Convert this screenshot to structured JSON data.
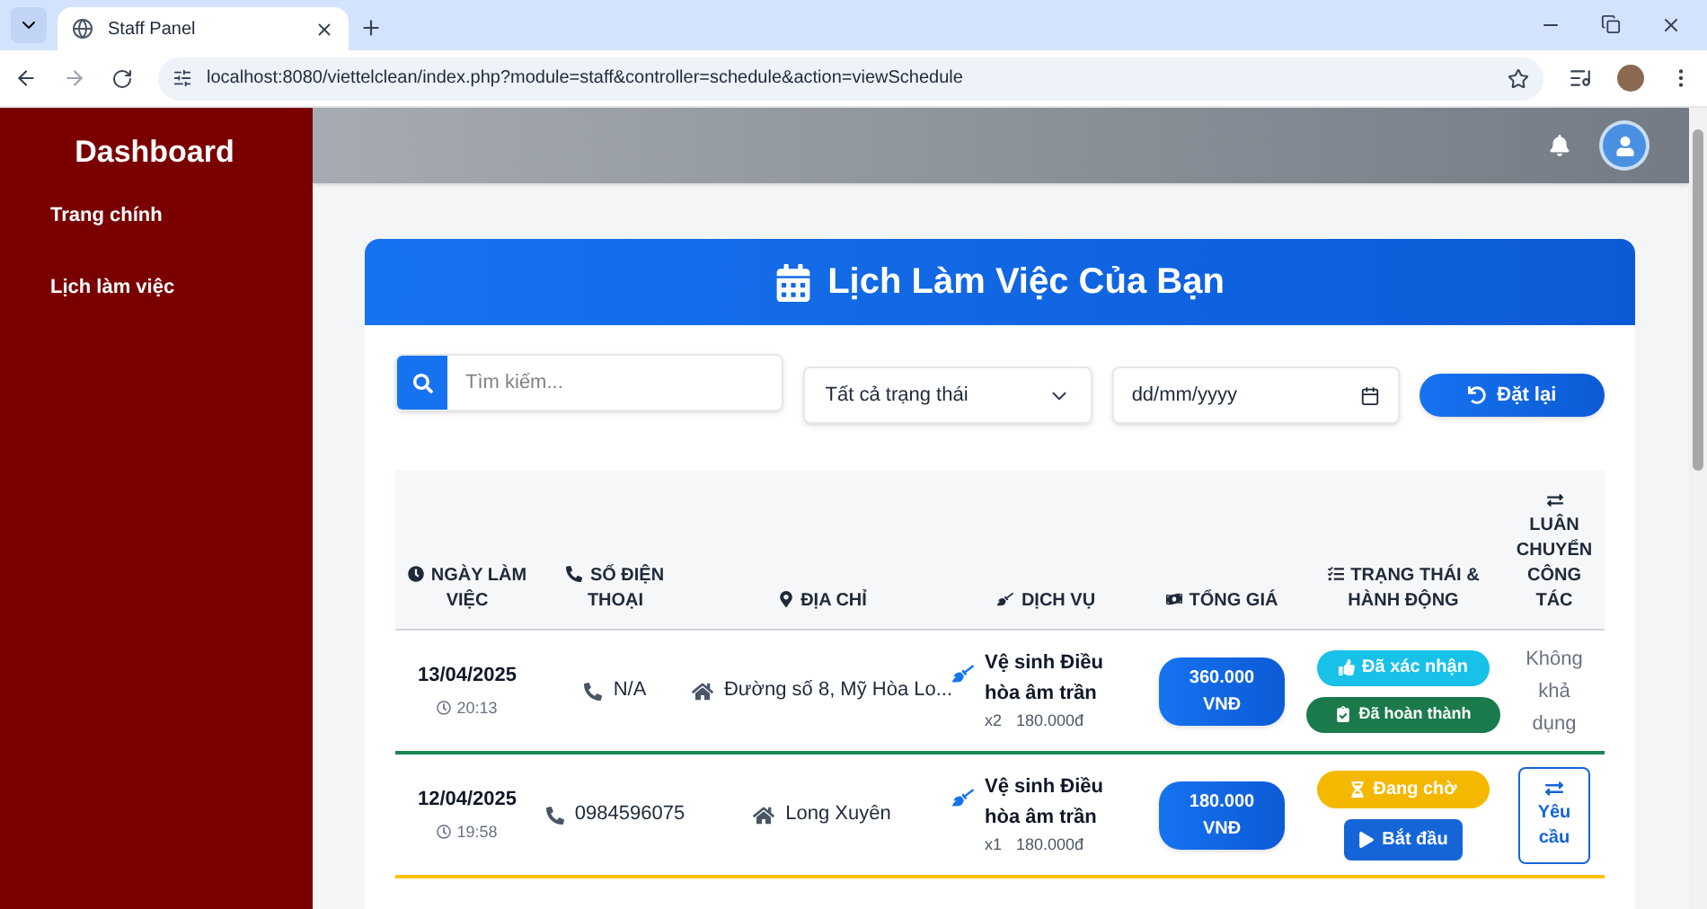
{
  "browser": {
    "tab_title": "Staff Panel",
    "url": "localhost:8080/viettelclean/index.php?module=staff&controller=schedule&action=viewSchedule"
  },
  "sidebar": {
    "title": "Dashboard",
    "items": [
      {
        "label": "Trang chính",
        "selected": false
      },
      {
        "label": "Lịch làm việc",
        "selected": false
      }
    ]
  },
  "card": {
    "title": "Lịch Làm Việc Của Bạn"
  },
  "filters": {
    "search": {
      "placeholder": "Tìm kiếm..."
    },
    "status_select": {
      "value": "Tất cả trạng thái"
    },
    "date": {
      "placeholder": "dd/mm/yyyy"
    },
    "reset_button": "Đặt lại"
  },
  "table": {
    "columns": [
      {
        "kind": "date",
        "label": "NGÀY LÀM VIỆC"
      },
      {
        "kind": "phone",
        "label": "SỐ ĐIỆN THOẠI"
      },
      {
        "kind": "address",
        "label": "ĐỊA CHỈ"
      },
      {
        "kind": "service",
        "label": "DỊCH VỤ"
      },
      {
        "kind": "total",
        "label": "TỔNG GIÁ"
      },
      {
        "kind": "status",
        "label": "TRẠNG THÁI & HÀNH ĐỘNG"
      },
      {
        "kind": "transfer",
        "label": "LUÂN CHUYỂN CÔNG TÁC"
      }
    ],
    "rows": [
      {
        "date": "13/04/2025",
        "time": "20:13",
        "phone": "N/A",
        "address": "Đường số 8, Mỹ Hòa Lo...",
        "service": "Vệ sinh Điều hòa âm trần",
        "quantity": "x2",
        "unit_price": "180.000đ",
        "total": [
          "360.000",
          "VNĐ"
        ],
        "actions": [
          {
            "kind": "confirmed",
            "label": "Đã xác nhận"
          },
          {
            "kind": "done",
            "label": "Đã hoàn thành"
          }
        ],
        "transfer": {
          "kind": "text",
          "label": "Không khả dụng"
        },
        "color": "#198754"
      },
      {
        "date": "12/04/2025",
        "time": "19:58",
        "phone": "0984596075",
        "address": "Long Xuyên",
        "service": "Vệ sinh Điều hòa âm trần",
        "quantity": "x1",
        "unit_price": "180.000đ",
        "total": [
          "180.000",
          "VNĐ"
        ],
        "actions": [
          {
            "kind": "pending",
            "label": "Đang chờ"
          },
          {
            "kind": "start",
            "label": "Bắt đầu"
          }
        ],
        "transfer": {
          "kind": "button",
          "label": "Yêu cầu"
        },
        "color": "#ffc107"
      }
    ]
  }
}
